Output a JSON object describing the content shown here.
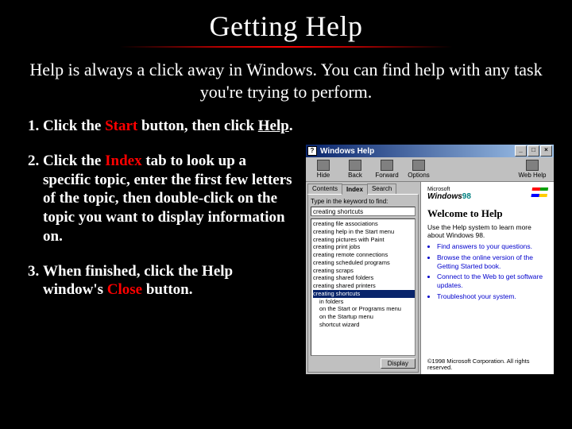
{
  "title": "Getting Help",
  "subtitle": "Help is always a click away in Windows. You can find help with any task you're trying to perform.",
  "steps": [
    {
      "pre": "Click the ",
      "kw": "Start",
      "mid": " button, then click ",
      "kw2": "Help",
      "post": "."
    },
    {
      "pre": "Click the ",
      "kw": "Index",
      "mid": " tab to look up a specific topic, enter the first few letters of the topic, then double-click on the topic you want to display information on.",
      "kw2": "",
      "post": ""
    },
    {
      "pre": "When finished, click the Help window's ",
      "kw": "Close",
      "mid": " button.",
      "kw2": "",
      "post": ""
    }
  ],
  "helpwin": {
    "title": "Windows Help",
    "toolbar": [
      "Hide",
      "Back",
      "Forward",
      "Options",
      "Web Help"
    ],
    "tabs": [
      "Contents",
      "Index",
      "Search"
    ],
    "active_tab": "Index",
    "prompt": "Type in the keyword to find:",
    "input_value": "creating shortcuts",
    "list": [
      "creating file associations",
      "creating help in the Start menu",
      "creating pictures with Paint",
      "creating print jobs",
      "creating remote connections",
      "creating scheduled programs",
      "creating scraps",
      "creating shared folders",
      "creating shared printers"
    ],
    "list_selected": "creating shortcuts",
    "list_sub": [
      "in folders",
      "on the Start or Programs menu",
      "on the Startup menu",
      "shortcut wizard"
    ],
    "display_btn": "Display",
    "brand_ms": "Microsoft",
    "brand_win": "Windows",
    "brand_yr": "98",
    "welcome": "Welcome to Help",
    "intro": "Use the Help system to learn more about Windows 98.",
    "bullets": [
      "Find answers to your questions.",
      "Browse the online version of the Getting Started book.",
      "Connect to the Web to get software updates.",
      "Troubleshoot your system."
    ],
    "copyright": "©1998 Microsoft Corporation. All rights reserved."
  }
}
